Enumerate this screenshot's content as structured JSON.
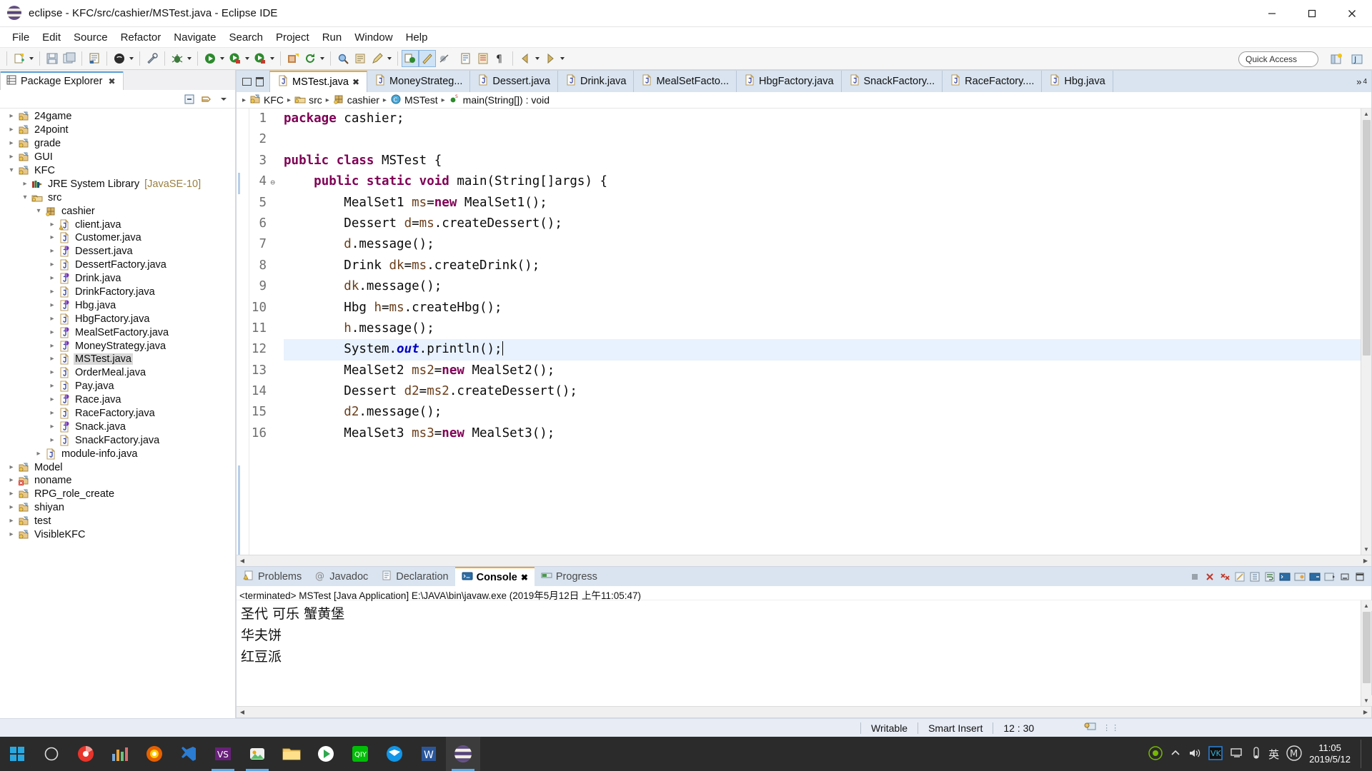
{
  "window": {
    "title": "eclipse - KFC/src/cashier/MSTest.java - Eclipse IDE",
    "minimize": "─",
    "maximize": "❐",
    "close": "✕"
  },
  "menubar": {
    "items": [
      "File",
      "Edit",
      "Source",
      "Refactor",
      "Navigate",
      "Search",
      "Project",
      "Run",
      "Window",
      "Help"
    ]
  },
  "toolbar": {
    "quick_access": "Quick Access",
    "icons": [
      "new-wizard-icon",
      "save-icon",
      "save-all-icon",
      "print-icon",
      "new-java-class-icon",
      "external-tools-icon",
      "debug-icon",
      "run-icon",
      "run-coverage-icon",
      "new-java-project-icon",
      "refresh-icon",
      "search-icon",
      "open-type-icon",
      "pencil-icon",
      "toggle-mark-occurrences-icon",
      "toggle-breadcrumb-icon",
      "skip-breakpoints-icon",
      "next-annotation-icon",
      "previous-annotation-icon",
      "show-whitespace-icon",
      "back-icon",
      "forward-icon"
    ],
    "perspective_buttons": [
      "open-perspective-icon",
      "java-perspective-icon"
    ]
  },
  "package_explorer": {
    "tab_label": "Package Explorer",
    "close_icon": "close-icon",
    "view_menu_icons": [
      "collapse-all-icon",
      "link-with-editor-icon",
      "view-menu-icon"
    ],
    "tree": [
      {
        "label": "24game",
        "depth": 0,
        "arrow": "collapsed",
        "icon": "java-project-icon"
      },
      {
        "label": "24point",
        "depth": 0,
        "arrow": "collapsed",
        "icon": "java-project-icon"
      },
      {
        "label": "grade",
        "depth": 0,
        "arrow": "collapsed",
        "icon": "java-project-icon"
      },
      {
        "label": "GUI",
        "depth": 0,
        "arrow": "collapsed",
        "icon": "java-project-icon"
      },
      {
        "label": "KFC",
        "depth": 0,
        "arrow": "expanded",
        "icon": "java-project-icon"
      },
      {
        "label": "JRE System Library",
        "depth": 1,
        "arrow": "collapsed",
        "icon": "library-icon",
        "suffix": "[JavaSE-10]"
      },
      {
        "label": "src",
        "depth": 1,
        "arrow": "expanded",
        "icon": "source-folder-icon"
      },
      {
        "label": "cashier",
        "depth": 2,
        "arrow": "expanded",
        "icon": "package-icon"
      },
      {
        "label": "client.java",
        "depth": 3,
        "arrow": "collapsed",
        "icon": "java-file-warning-icon"
      },
      {
        "label": "Customer.java",
        "depth": 3,
        "arrow": "collapsed",
        "icon": "java-file-icon"
      },
      {
        "label": "Dessert.java",
        "depth": 3,
        "arrow": "collapsed",
        "icon": "java-interface-file-icon"
      },
      {
        "label": "DessertFactory.java",
        "depth": 3,
        "arrow": "collapsed",
        "icon": "java-file-icon"
      },
      {
        "label": "Drink.java",
        "depth": 3,
        "arrow": "collapsed",
        "icon": "java-interface-file-icon"
      },
      {
        "label": "DrinkFactory.java",
        "depth": 3,
        "arrow": "collapsed",
        "icon": "java-file-icon"
      },
      {
        "label": "Hbg.java",
        "depth": 3,
        "arrow": "collapsed",
        "icon": "java-interface-file-icon"
      },
      {
        "label": "HbgFactory.java",
        "depth": 3,
        "arrow": "collapsed",
        "icon": "java-file-icon"
      },
      {
        "label": "MealSetFactory.java",
        "depth": 3,
        "arrow": "collapsed",
        "icon": "java-interface-file-icon"
      },
      {
        "label": "MoneyStrategy.java",
        "depth": 3,
        "arrow": "collapsed",
        "icon": "java-interface-file-icon"
      },
      {
        "label": "MSTest.java",
        "depth": 3,
        "arrow": "collapsed",
        "icon": "java-file-icon",
        "selected": true
      },
      {
        "label": "OrderMeal.java",
        "depth": 3,
        "arrow": "collapsed",
        "icon": "java-file-icon"
      },
      {
        "label": "Pay.java",
        "depth": 3,
        "arrow": "collapsed",
        "icon": "java-file-icon"
      },
      {
        "label": "Race.java",
        "depth": 3,
        "arrow": "collapsed",
        "icon": "java-interface-file-icon"
      },
      {
        "label": "RaceFactory.java",
        "depth": 3,
        "arrow": "collapsed",
        "icon": "java-file-icon"
      },
      {
        "label": "Snack.java",
        "depth": 3,
        "arrow": "collapsed",
        "icon": "java-interface-file-icon"
      },
      {
        "label": "SnackFactory.java",
        "depth": 3,
        "arrow": "collapsed",
        "icon": "java-file-icon"
      },
      {
        "label": "module-info.java",
        "depth": 2,
        "arrow": "collapsed",
        "icon": "java-file-icon"
      },
      {
        "label": "Model",
        "depth": 0,
        "arrow": "collapsed",
        "icon": "java-project-icon"
      },
      {
        "label": "noname",
        "depth": 0,
        "arrow": "collapsed",
        "icon": "java-project-error-icon"
      },
      {
        "label": "RPG_role_create",
        "depth": 0,
        "arrow": "collapsed",
        "icon": "java-project-icon"
      },
      {
        "label": "shiyan",
        "depth": 0,
        "arrow": "collapsed",
        "icon": "java-project-icon"
      },
      {
        "label": "test",
        "depth": 0,
        "arrow": "collapsed",
        "icon": "java-project-icon"
      },
      {
        "label": "VisibleKFC",
        "depth": 0,
        "arrow": "collapsed",
        "icon": "java-project-icon"
      }
    ]
  },
  "editor": {
    "minimize_icon": "minimize-icon",
    "maximize_icon": "maximize-icon",
    "tabs": [
      {
        "label": "MSTest.java",
        "active": true,
        "close_icon": "close-icon"
      },
      {
        "label": "MoneyStrateg...",
        "active": false
      },
      {
        "label": "Dessert.java",
        "active": false
      },
      {
        "label": "Drink.java",
        "active": false
      },
      {
        "label": "MealSetFacto...",
        "active": false
      },
      {
        "label": "HbgFactory.java",
        "active": false
      },
      {
        "label": "SnackFactory...",
        "active": false
      },
      {
        "label": "RaceFactory....",
        "active": false
      },
      {
        "label": "Hbg.java",
        "active": false
      }
    ],
    "tab_overflow": "»",
    "tab_overflow_count": "4",
    "breadcrumb": [
      {
        "label": "KFC",
        "icon": "java-project-icon"
      },
      {
        "label": "src",
        "icon": "source-folder-icon"
      },
      {
        "label": "cashier",
        "icon": "package-icon"
      },
      {
        "label": "MSTest",
        "icon": "class-icon"
      },
      {
        "label": "main(String[]) : void",
        "icon": "method-static-icon"
      }
    ],
    "code_lines": [
      {
        "n": 1,
        "fold": false,
        "tokens": [
          {
            "t": "package ",
            "c": "kw"
          },
          {
            "t": "cashier;",
            "c": ""
          }
        ]
      },
      {
        "n": 2,
        "fold": false,
        "tokens": []
      },
      {
        "n": 3,
        "fold": false,
        "tokens": [
          {
            "t": "public class ",
            "c": "kw"
          },
          {
            "t": "MSTest {",
            "c": ""
          }
        ]
      },
      {
        "n": 4,
        "fold": true,
        "tokens": [
          {
            "t": "    ",
            "c": ""
          },
          {
            "t": "public static void ",
            "c": "kw"
          },
          {
            "t": "main(String[]args) {",
            "c": ""
          }
        ]
      },
      {
        "n": 5,
        "fold": false,
        "tokens": [
          {
            "t": "        MealSet1 ",
            "c": ""
          },
          {
            "t": "ms",
            "c": "var"
          },
          {
            "t": "=",
            "c": ""
          },
          {
            "t": "new ",
            "c": "kw"
          },
          {
            "t": "MealSet1();",
            "c": ""
          }
        ]
      },
      {
        "n": 6,
        "fold": false,
        "tokens": [
          {
            "t": "        Dessert ",
            "c": ""
          },
          {
            "t": "d",
            "c": "var"
          },
          {
            "t": "=",
            "c": ""
          },
          {
            "t": "ms",
            "c": "var"
          },
          {
            "t": ".createDessert();",
            "c": ""
          }
        ]
      },
      {
        "n": 7,
        "fold": false,
        "tokens": [
          {
            "t": "        ",
            "c": ""
          },
          {
            "t": "d",
            "c": "var"
          },
          {
            "t": ".message();",
            "c": ""
          }
        ]
      },
      {
        "n": 8,
        "fold": false,
        "tokens": [
          {
            "t": "        Drink ",
            "c": ""
          },
          {
            "t": "dk",
            "c": "var"
          },
          {
            "t": "=",
            "c": ""
          },
          {
            "t": "ms",
            "c": "var"
          },
          {
            "t": ".createDrink();",
            "c": ""
          }
        ]
      },
      {
        "n": 9,
        "fold": false,
        "tokens": [
          {
            "t": "        ",
            "c": ""
          },
          {
            "t": "dk",
            "c": "var"
          },
          {
            "t": ".message();",
            "c": ""
          }
        ]
      },
      {
        "n": 10,
        "fold": false,
        "tokens": [
          {
            "t": "        Hbg ",
            "c": ""
          },
          {
            "t": "h",
            "c": "var"
          },
          {
            "t": "=",
            "c": ""
          },
          {
            "t": "ms",
            "c": "var"
          },
          {
            "t": ".createHbg();",
            "c": ""
          }
        ]
      },
      {
        "n": 11,
        "fold": false,
        "tokens": [
          {
            "t": "        ",
            "c": ""
          },
          {
            "t": "h",
            "c": "var"
          },
          {
            "t": ".message();",
            "c": ""
          }
        ]
      },
      {
        "n": 12,
        "fold": false,
        "highlight": true,
        "caret": true,
        "tokens": [
          {
            "t": "        System.",
            "c": ""
          },
          {
            "t": "out",
            "c": "fld"
          },
          {
            "t": ".println();",
            "c": ""
          }
        ]
      },
      {
        "n": 13,
        "fold": false,
        "tokens": [
          {
            "t": "        MealSet2 ",
            "c": ""
          },
          {
            "t": "ms2",
            "c": "var"
          },
          {
            "t": "=",
            "c": ""
          },
          {
            "t": "new ",
            "c": "kw"
          },
          {
            "t": "MealSet2();",
            "c": ""
          }
        ]
      },
      {
        "n": 14,
        "fold": false,
        "tokens": [
          {
            "t": "        Dessert ",
            "c": ""
          },
          {
            "t": "d2",
            "c": "var"
          },
          {
            "t": "=",
            "c": ""
          },
          {
            "t": "ms2",
            "c": "var"
          },
          {
            "t": ".createDessert();",
            "c": ""
          }
        ]
      },
      {
        "n": 15,
        "fold": false,
        "tokens": [
          {
            "t": "        ",
            "c": ""
          },
          {
            "t": "d2",
            "c": "var"
          },
          {
            "t": ".message();",
            "c": ""
          }
        ]
      },
      {
        "n": 16,
        "fold": false,
        "tokens": [
          {
            "t": "        MealSet3 ",
            "c": ""
          },
          {
            "t": "ms3",
            "c": "var"
          },
          {
            "t": "=",
            "c": ""
          },
          {
            "t": "new ",
            "c": "kw"
          },
          {
            "t": "MealSet3();",
            "c": ""
          }
        ]
      }
    ]
  },
  "console_panel": {
    "tabs": [
      {
        "label": "Problems",
        "icon": "problems-icon",
        "active": false
      },
      {
        "label": "Javadoc",
        "icon": "javadoc-icon",
        "active": false
      },
      {
        "label": "Declaration",
        "icon": "declaration-icon",
        "active": false
      },
      {
        "label": "Console",
        "icon": "console-icon",
        "active": true,
        "close_icon": "close-icon"
      },
      {
        "label": "Progress",
        "icon": "progress-icon",
        "active": false
      }
    ],
    "tools": [
      "terminate-icon",
      "remove-launch-icon",
      "remove-all-launches-icon",
      "clear-console-icon",
      "scroll-lock-icon",
      "word-wrap-icon",
      "show-console-on-output-icon",
      "pin-console-icon",
      "display-selected-console-icon",
      "open-console-icon",
      "minimize-icon",
      "maximize-icon"
    ],
    "terminated_line": "<terminated> MSTest [Java Application] E:\\JAVA\\bin\\javaw.exe (2019年5月12日 上午11:05:47)",
    "output_lines": [
      "圣代  可乐  蟹黄堡",
      "华夫饼",
      "红豆派"
    ]
  },
  "statusbar": {
    "writable": "Writable",
    "insert_mode": "Smart Insert",
    "position": "12 : 30",
    "indicator_icon": "remote-systems-icon"
  },
  "taskbar": {
    "items": [
      "start-icon",
      "cortana-icon",
      "security-icon",
      "stats-app-icon",
      "firefox-icon",
      "vscode-icon",
      "visual-studio-icon",
      "photos-icon",
      "file-explorer-icon",
      "play-store-icon",
      "iqiyi-icon",
      "thunderbird-icon",
      "word-icon",
      "eclipse-icon"
    ],
    "tray": [
      "nvidia-icon",
      "show-hidden-icon",
      "volume-icon",
      "input-method-vk-icon",
      "network-icon",
      "battery-icon",
      "lang-icon",
      "ime-m-icon"
    ],
    "clock_time": "11:05",
    "clock_date": "2019/5/12",
    "lang_label": "英",
    "show_desktop": "show-desktop-bar"
  }
}
